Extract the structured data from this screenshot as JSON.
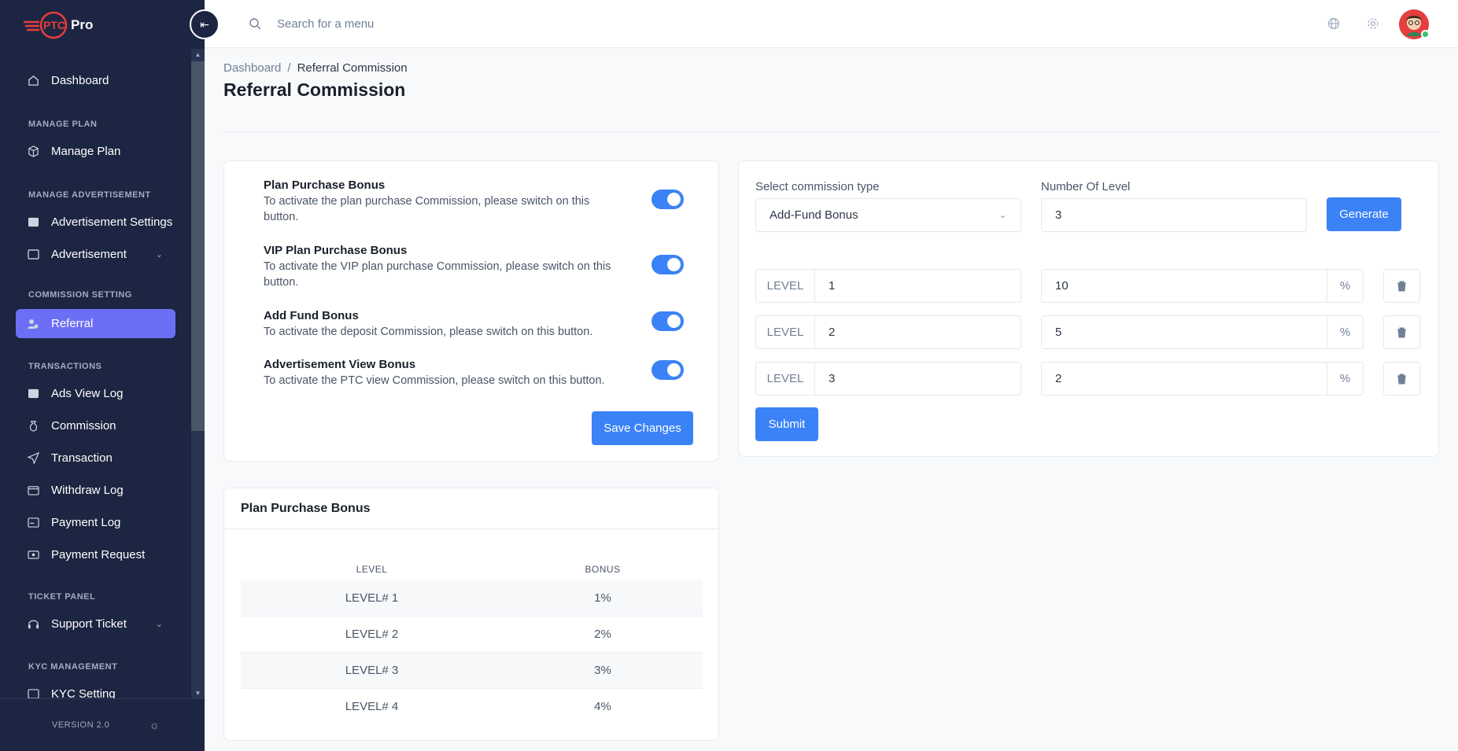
{
  "brand": {
    "logo_part1": "PTC",
    "logo_part2": "Pro"
  },
  "sidebar": {
    "items": [
      {
        "label": "Dashboard",
        "icon": "home-icon"
      },
      {
        "label": "Manage Plan",
        "icon": "box-icon"
      },
      {
        "label": "Advertisement Settings",
        "icon": "ad-icon"
      },
      {
        "label": "Advertisement",
        "icon": "ad-icon"
      },
      {
        "label": "Referral",
        "icon": "users-icon"
      },
      {
        "label": "Ads View Log",
        "icon": "ad-icon"
      },
      {
        "label": "Commission",
        "icon": "money-bag-icon"
      },
      {
        "label": "Transaction",
        "icon": "send-icon"
      },
      {
        "label": "Withdraw Log",
        "icon": "wallet-icon"
      },
      {
        "label": "Payment Log",
        "icon": "card-icon"
      },
      {
        "label": "Payment Request",
        "icon": "cash-icon"
      },
      {
        "label": "Support Ticket",
        "icon": "headset-icon"
      },
      {
        "label": "KYC Setting",
        "icon": "id-icon"
      }
    ],
    "sections": [
      "MANAGE PLAN",
      "MANAGE ADVERTISEMENT",
      "COMMISSION SETTING",
      "TRANSACTIONS",
      "TICKET PANEL",
      "KYC MANAGEMENT"
    ],
    "version": "VERSION 2.0"
  },
  "topbar": {
    "search_placeholder": "Search for a menu"
  },
  "breadcrumb": {
    "home": "Dashboard",
    "current": "Referral Commission"
  },
  "page_title": "Referral Commission",
  "bonuses": [
    {
      "title": "Plan Purchase Bonus",
      "desc": "To activate the plan purchase Commission, please switch on this button.",
      "enabled": true
    },
    {
      "title": "VIP Plan Purchase Bonus",
      "desc": "To activate the VIP plan purchase Commission, please switch on this button.",
      "enabled": true
    },
    {
      "title": "Add Fund Bonus",
      "desc": "To activate the deposit Commission, please switch on this button.",
      "enabled": true
    },
    {
      "title": "Advertisement View Bonus",
      "desc": "To activate the PTC view Commission, please switch on this button.",
      "enabled": true
    }
  ],
  "save_label": "Save Changes",
  "commission_form": {
    "type_label": "Select commission type",
    "type_value": "Add-Fund Bonus",
    "levels_label": "Number Of Level",
    "levels_value": "3",
    "generate_label": "Generate",
    "level_prefix": "LEVEL",
    "percent_suffix": "%",
    "rows": [
      {
        "level": "1",
        "value": "10"
      },
      {
        "level": "2",
        "value": "5"
      },
      {
        "level": "3",
        "value": "2"
      }
    ],
    "submit_label": "Submit"
  },
  "plan_table": {
    "title": "Plan Purchase Bonus",
    "headers": [
      "LEVEL",
      "BONUS"
    ],
    "rows": [
      [
        "LEVEL# 1",
        "1%"
      ],
      [
        "LEVEL# 2",
        "2%"
      ],
      [
        "LEVEL# 3",
        "3%"
      ],
      [
        "LEVEL# 4",
        "4%"
      ]
    ]
  },
  "colors": {
    "sidebar_bg": "#1c2541",
    "active": "#6c6ff5",
    "primary": "#3b82f6"
  }
}
